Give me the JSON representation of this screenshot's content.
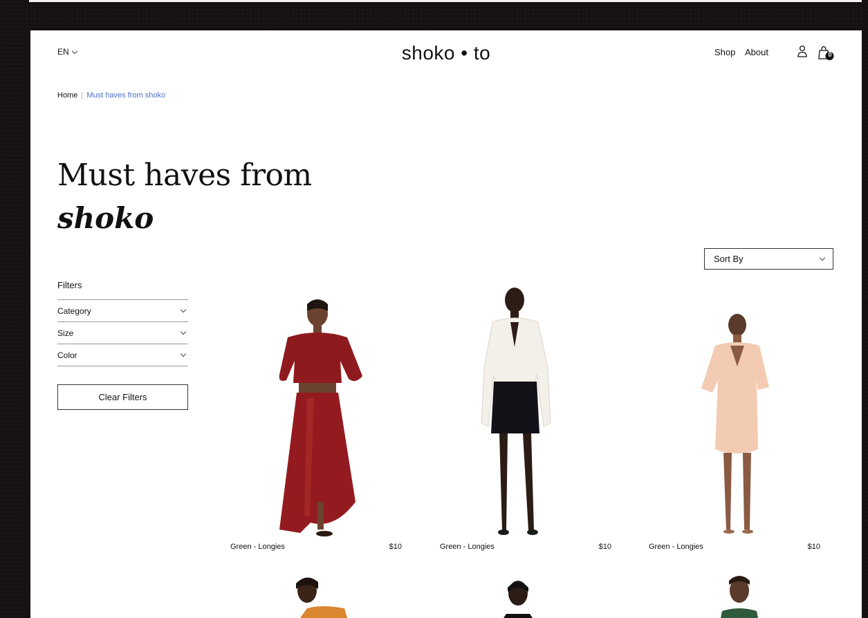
{
  "header": {
    "language": "EN",
    "logo": "shoko • to",
    "nav": [
      {
        "label": "Shop"
      },
      {
        "label": "About"
      }
    ],
    "cart_count": "0",
    "icons": [
      "user-icon",
      "shopping-bag-icon",
      "chevron-down-icon"
    ]
  },
  "breadcrumb": {
    "home": "Home",
    "current": "Must haves from shoko"
  },
  "page": {
    "title_line1": "Must haves from",
    "title_line2": "shoko"
  },
  "sort": {
    "label": "Sort By"
  },
  "filters": {
    "title": "Filters",
    "items": [
      {
        "label": "Category"
      },
      {
        "label": "Size"
      },
      {
        "label": "Color"
      }
    ],
    "clear_label": "Clear Filters"
  },
  "products": [
    {
      "name": "Green - Longies",
      "price": "$10",
      "image": "model in red patterned off-shoulder top and skirt"
    },
    {
      "name": "Green - Longies",
      "price": "$10",
      "image": "model in white blouse and black mini skirt"
    },
    {
      "name": "Green - Longies",
      "price": "$10",
      "image": "model in peach wrap mini dress"
    }
  ],
  "colors": {
    "link_accent": "#4a6fc9",
    "background": "#141110",
    "panel": "#ffffff"
  }
}
